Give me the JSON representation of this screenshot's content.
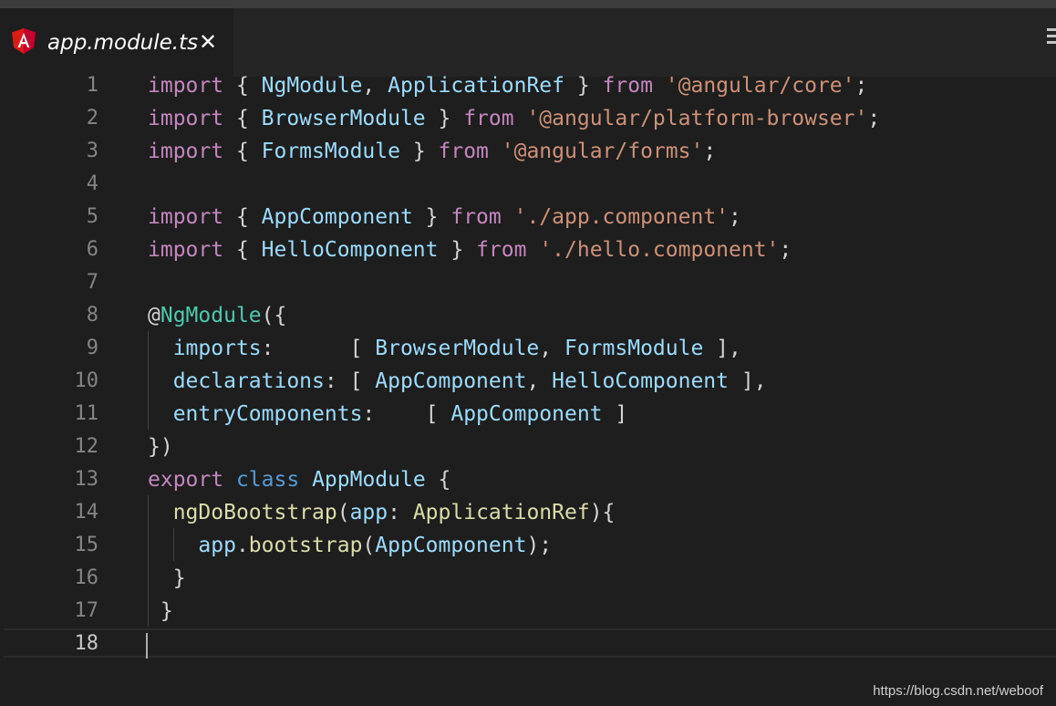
{
  "window": {
    "tab": {
      "title": "app.module.ts",
      "close_glyph": "✕",
      "file_icon": "angular-icon",
      "more_icon": "more-icon"
    }
  },
  "colors": {
    "keyword": "#c586c0",
    "storage": "#569cd6",
    "variable": "#9cdcfe",
    "string": "#ce9178",
    "decorator": "#4ec9b0",
    "function": "#dcdcaa",
    "punctuation": "#d4d4d4"
  },
  "editor": {
    "active_line": 18,
    "lines": [
      {
        "n": "1",
        "tokens": [
          [
            "kw",
            "import"
          ],
          [
            "pn",
            " { "
          ],
          [
            "id",
            "NgModule"
          ],
          [
            "pn",
            ", "
          ],
          [
            "id",
            "ApplicationRef"
          ],
          [
            "pn",
            " } "
          ],
          [
            "kw",
            "from"
          ],
          [
            "pn",
            " "
          ],
          [
            "str",
            "'@angular/core'"
          ],
          [
            "pn",
            ";"
          ]
        ]
      },
      {
        "n": "2",
        "tokens": [
          [
            "kw",
            "import"
          ],
          [
            "pn",
            " { "
          ],
          [
            "id",
            "BrowserModule"
          ],
          [
            "pn",
            " } "
          ],
          [
            "kw",
            "from"
          ],
          [
            "pn",
            " "
          ],
          [
            "str",
            "'@angular/platform-browser'"
          ],
          [
            "pn",
            ";"
          ]
        ]
      },
      {
        "n": "3",
        "tokens": [
          [
            "kw",
            "import"
          ],
          [
            "pn",
            " { "
          ],
          [
            "id",
            "FormsModule"
          ],
          [
            "pn",
            " } "
          ],
          [
            "kw",
            "from"
          ],
          [
            "pn",
            " "
          ],
          [
            "str",
            "'@angular/forms'"
          ],
          [
            "pn",
            ";"
          ]
        ]
      },
      {
        "n": "4",
        "tokens": []
      },
      {
        "n": "5",
        "tokens": [
          [
            "kw",
            "import"
          ],
          [
            "pn",
            " { "
          ],
          [
            "id",
            "AppComponent"
          ],
          [
            "pn",
            " } "
          ],
          [
            "kw",
            "from"
          ],
          [
            "pn",
            " "
          ],
          [
            "str",
            "'./app.component'"
          ],
          [
            "pn",
            ";"
          ]
        ]
      },
      {
        "n": "6",
        "tokens": [
          [
            "kw",
            "import"
          ],
          [
            "pn",
            " { "
          ],
          [
            "id",
            "HelloComponent"
          ],
          [
            "pn",
            " } "
          ],
          [
            "kw",
            "from"
          ],
          [
            "pn",
            " "
          ],
          [
            "str",
            "'./hello.component'"
          ],
          [
            "pn",
            ";"
          ]
        ]
      },
      {
        "n": "7",
        "tokens": []
      },
      {
        "n": "8",
        "tokens": [
          [
            "pn",
            "@"
          ],
          [
            "dec",
            "NgModule"
          ],
          [
            "pn",
            "({"
          ]
        ]
      },
      {
        "n": "9",
        "tokens": [
          [
            "pn",
            "  "
          ],
          [
            "id",
            "imports"
          ],
          [
            "pn",
            ":      [ "
          ],
          [
            "id",
            "BrowserModule"
          ],
          [
            "pn",
            ", "
          ],
          [
            "id",
            "FormsModule"
          ],
          [
            "pn",
            " ],"
          ]
        ]
      },
      {
        "n": "10",
        "tokens": [
          [
            "pn",
            "  "
          ],
          [
            "id",
            "declarations"
          ],
          [
            "pn",
            ": [ "
          ],
          [
            "id",
            "AppComponent"
          ],
          [
            "pn",
            ", "
          ],
          [
            "id",
            "HelloComponent"
          ],
          [
            "pn",
            " ],"
          ]
        ]
      },
      {
        "n": "11",
        "tokens": [
          [
            "pn",
            "  "
          ],
          [
            "id",
            "entryComponents"
          ],
          [
            "pn",
            ":    [ "
          ],
          [
            "id",
            "AppComponent"
          ],
          [
            "pn",
            " ]"
          ]
        ]
      },
      {
        "n": "12",
        "tokens": [
          [
            "pn",
            "})"
          ]
        ]
      },
      {
        "n": "13",
        "tokens": [
          [
            "kw",
            "export"
          ],
          [
            "pn",
            " "
          ],
          [
            "kw2",
            "class"
          ],
          [
            "pn",
            " "
          ],
          [
            "id",
            "AppModule"
          ],
          [
            "pn",
            " {"
          ]
        ]
      },
      {
        "n": "14",
        "tokens": [
          [
            "pn",
            "  "
          ],
          [
            "fn",
            "ngDoBootstrap"
          ],
          [
            "pn",
            "("
          ],
          [
            "id",
            "app"
          ],
          [
            "pn",
            ": "
          ],
          [
            "fn",
            "ApplicationRef"
          ],
          [
            "pn",
            "){"
          ]
        ]
      },
      {
        "n": "15",
        "tokens": [
          [
            "pn",
            "    "
          ],
          [
            "id",
            "app"
          ],
          [
            "pn",
            "."
          ],
          [
            "fn",
            "bootstrap"
          ],
          [
            "pn",
            "("
          ],
          [
            "id",
            "AppComponent"
          ],
          [
            "pn",
            ");"
          ]
        ]
      },
      {
        "n": "16",
        "tokens": [
          [
            "pn",
            "  }"
          ]
        ]
      },
      {
        "n": "17",
        "tokens": [
          [
            "pn",
            " }"
          ]
        ]
      },
      {
        "n": "18",
        "tokens": []
      }
    ]
  },
  "watermark": "https://blog.csdn.net/weboof"
}
